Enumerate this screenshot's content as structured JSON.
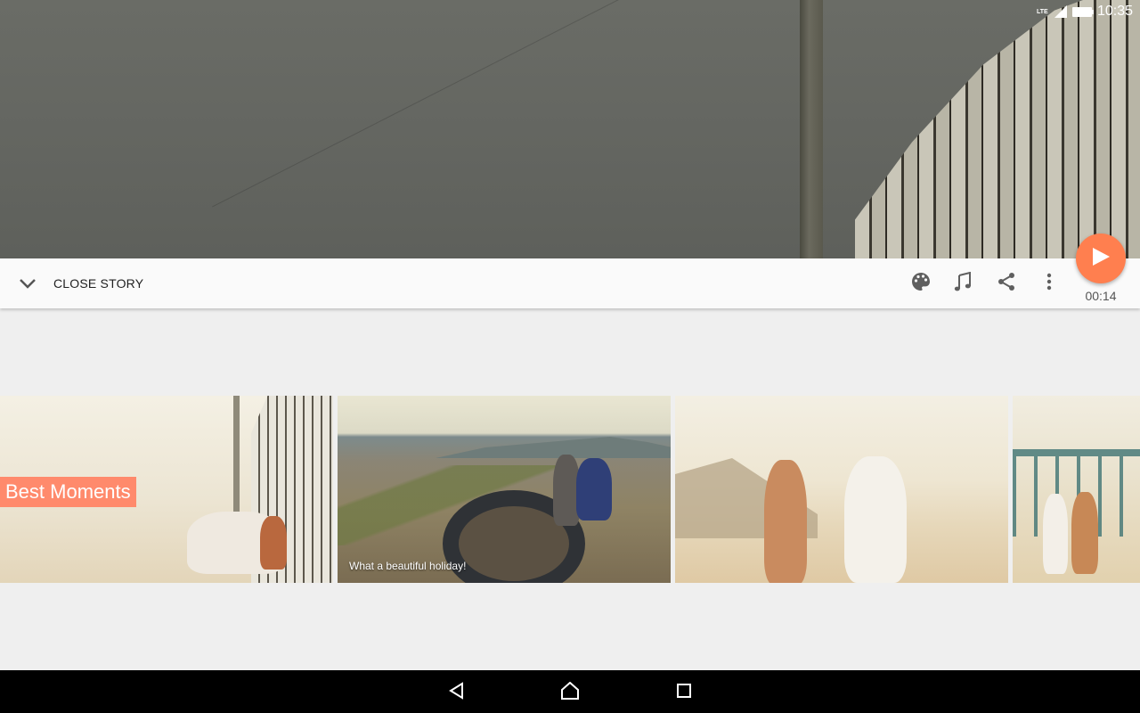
{
  "status_bar": {
    "network": "LTE",
    "time": "10:35"
  },
  "toolbar": {
    "close_label": "CLOSE STORY",
    "duration": "00:14",
    "icons": [
      "chevron-down-icon",
      "palette-icon",
      "music-note-icon",
      "share-icon",
      "more-vert-icon",
      "play-icon"
    ]
  },
  "story": {
    "title": "Best Moments",
    "caption": "What a beautiful holiday!"
  },
  "nav": {
    "icons": [
      "back-icon",
      "home-icon",
      "recents-icon"
    ]
  },
  "colors": {
    "accent": "#ff7f4f",
    "title_bg": "#ff8a6c",
    "toolbar_bg": "#fafafa",
    "page_bg": "#efefef"
  }
}
